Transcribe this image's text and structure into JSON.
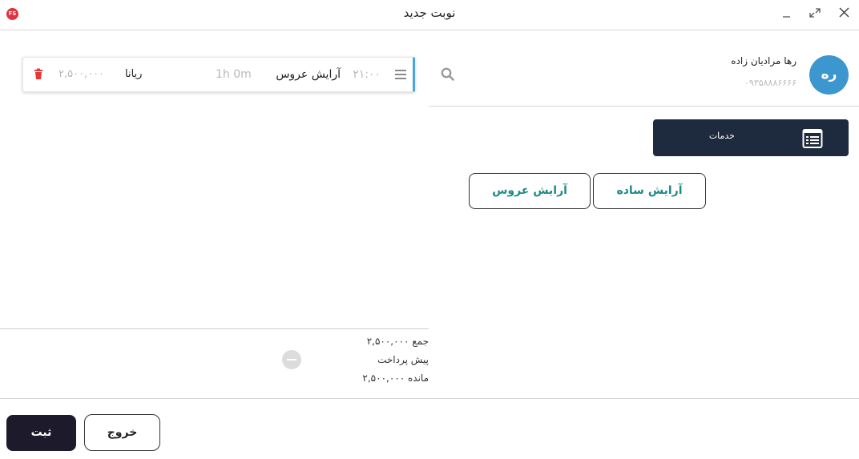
{
  "window": {
    "title": "نوبت جدید",
    "logo_text": "FS",
    "logo_color": "#e0313d"
  },
  "appointment": {
    "time": "۲۱:۰۰",
    "service": "آرایش عروس",
    "duration": "1h 0m",
    "staff": "ریانا",
    "price": "۲,۵۰۰,۰۰۰",
    "accent_color": "#4aa3df",
    "delete_icon_color": "#e53935"
  },
  "totals": {
    "sum": "جمع ۲,۵۰۰,۰۰۰",
    "prepayment": "پیش پرداخت",
    "remaining": "مانده ۲,۵۰۰,۰۰۰"
  },
  "customer": {
    "initials": "ره",
    "name": "رها مرادیان زاده",
    "phone": "۰۹۳۵۸۸۸۶۶۶۶",
    "avatar_color": "#3d97cf"
  },
  "services_tab": {
    "label": "خدمات",
    "background": "#1e2a3d"
  },
  "service_options": [
    {
      "label": "آرایش ساده"
    },
    {
      "label": "آرایش عروس"
    }
  ],
  "service_text_color": "#1d8a86",
  "footer": {
    "submit_label": "ثبت",
    "exit_label": "خروج"
  },
  "icons": {
    "minimize": "minimize-icon",
    "maximize": "maximize-icon",
    "close": "close-icon",
    "search": "search-icon",
    "drag": "drag-handle-icon",
    "delete": "trash-icon",
    "services": "list-icon",
    "remove": "minus-circle-icon"
  }
}
